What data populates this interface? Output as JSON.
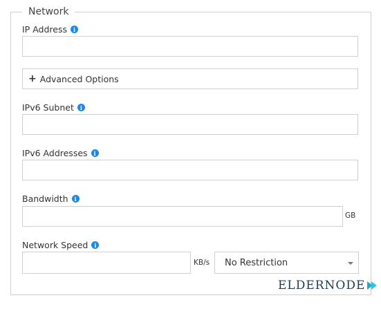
{
  "fieldset": {
    "legend": "Network"
  },
  "ip": {
    "label": "IP Address",
    "value": ""
  },
  "advanced": {
    "label": "Advanced Options"
  },
  "ipv6_subnet": {
    "label": "IPv6 Subnet",
    "value": ""
  },
  "ipv6_addresses": {
    "label": "IPv6 Addresses",
    "value": ""
  },
  "bandwidth": {
    "label": "Bandwidth",
    "unit": "GB",
    "value": ""
  },
  "network_speed": {
    "label": "Network Speed",
    "unit": "KB/s",
    "value": "",
    "restriction": "No Restriction"
  },
  "logo": {
    "text": "ELDERNODE"
  },
  "icons": {
    "info": "info-icon",
    "plus": "plus-icon",
    "caret": "chevron-down-icon"
  }
}
